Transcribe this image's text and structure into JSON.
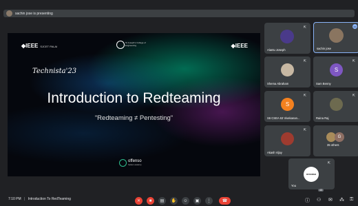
{
  "banner": {
    "text": "sachin jose is presenting"
  },
  "slide": {
    "brand_left": "◆IEEE",
    "brand_left_sub": "SJCET PALAI",
    "brand_right": "◆IEEE",
    "seal_text": "St Joseph's College of Engineering",
    "event": "Technista'23",
    "title": "Introduction to Redteaming",
    "subtitle": "\"Redteaming ≠ Pentesting\"",
    "sponsor": "offenso",
    "sponsor_sub": "hackers academy"
  },
  "participants": [
    {
      "name": "Alantu Joseph"
    },
    {
      "name": "sachin jose"
    },
    {
      "name": "Shema Abraham"
    },
    {
      "name": "Sam Benny",
      "initial": "S"
    },
    {
      "name": "S6 CSEA 63 Vivekanan...",
      "initial": "S"
    },
    {
      "name": "Raina Raj"
    },
    {
      "name": "Akash Vijay"
    },
    {
      "name": "35 others",
      "initial": "G"
    },
    {
      "name": "You",
      "logo": "OFFENSO"
    }
  ],
  "bottom": {
    "time": "7:10 PM",
    "separator": "|",
    "meeting": "Introduction To RedTeaming",
    "participant_count": "43"
  },
  "colors": {
    "accent": "#8ab4f8",
    "danger": "#ea4335",
    "tile": "#3c4043",
    "background": "#202124"
  }
}
